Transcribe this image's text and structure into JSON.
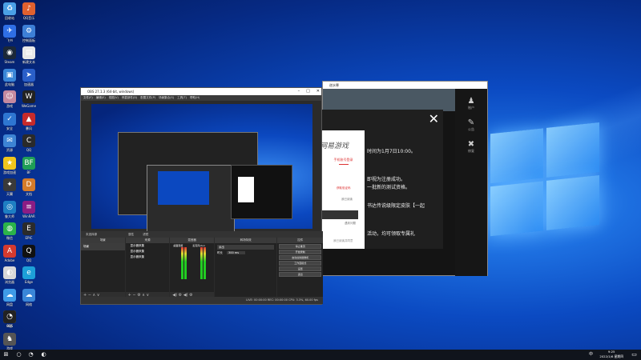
{
  "desktop_icons": [
    {
      "label": "回收站",
      "icon": "recycle-bin-icon",
      "color": "#4aa0e6",
      "glyph": "♻"
    },
    {
      "label": "QQ音乐",
      "icon": "music-app-icon",
      "color": "#e0612f",
      "glyph": "♪"
    },
    {
      "label": "飞书",
      "icon": "feishu-icon",
      "color": "#2f6fe6",
      "glyph": "✈"
    },
    {
      "label": "控制面板",
      "icon": "control-panel-icon",
      "color": "#3d7fd6",
      "glyph": "⚙"
    },
    {
      "label": "Steam",
      "icon": "steam-icon",
      "color": "#1b2838",
      "glyph": "◉"
    },
    {
      "label": "新建文本",
      "icon": "text-file-icon",
      "color": "#e8e8e8",
      "glyph": "▤"
    },
    {
      "label": "此电脑",
      "icon": "computer-icon",
      "color": "#3a86d8",
      "glyph": "▣"
    },
    {
      "label": "加速器",
      "icon": "accelerator-icon",
      "color": "#2a5fc9",
      "glyph": "➤"
    },
    {
      "label": "游戏",
      "icon": "game-avatar-icon",
      "color": "#c58aa0",
      "glyph": "☺"
    },
    {
      "label": "WeGame",
      "icon": "wegame-icon",
      "color": "#222222",
      "glyph": "W"
    },
    {
      "label": "安全",
      "icon": "shield-app-icon",
      "color": "#2e76d1",
      "glyph": "✓"
    },
    {
      "label": "暴风",
      "icon": "storm-icon",
      "color": "#c72b2b",
      "glyph": "▲"
    },
    {
      "label": "资源",
      "icon": "resource-icon",
      "color": "#3d84d4",
      "glyph": "✉"
    },
    {
      "label": "QQ",
      "icon": "cloud-app-icon",
      "color": "#2a2a2a",
      "glyph": "C"
    },
    {
      "label": "游戏加速",
      "icon": "game-speed-icon",
      "color": "#f0c51c",
      "glyph": "★"
    },
    {
      "label": "BF",
      "icon": "bf-app-icon",
      "color": "#1f9e57",
      "glyph": "BF"
    },
    {
      "label": "天翼",
      "icon": "wing-icon",
      "color": "#3a3a3a",
      "glyph": "✦"
    },
    {
      "label": "文档",
      "icon": "office-icon",
      "color": "#d47b2a",
      "glyph": "D"
    },
    {
      "label": "鲁大师",
      "icon": "tuning-icon",
      "color": "#1e7fc3",
      "glyph": "◎"
    },
    {
      "label": "WinRAR",
      "icon": "winrar-icon",
      "color": "#8b1d84",
      "glyph": "≡"
    },
    {
      "label": "微信",
      "icon": "wechat-icon",
      "color": "#2bb34a",
      "glyph": "◍"
    },
    {
      "label": "EPIC",
      "icon": "epic-icon",
      "color": "#2b2b2b",
      "glyph": "E"
    },
    {
      "label": "Adobe",
      "icon": "adobe-icon",
      "color": "#d43a2f",
      "glyph": "A"
    },
    {
      "label": "QQ",
      "icon": "qq-icon",
      "color": "#111111",
      "glyph": "Q"
    },
    {
      "label": "浏览器",
      "icon": "browser-icon",
      "color": "#d8d8d8",
      "glyph": "◐"
    },
    {
      "label": "Edge",
      "icon": "edge-icon",
      "color": "#1da0d8",
      "glyph": "e"
    },
    {
      "label": "网盘",
      "icon": "cloud-drive-icon",
      "color": "#3f9be8",
      "glyph": "☁"
    },
    {
      "label": "网络",
      "icon": "network-icon",
      "color": "#3a86d8",
      "glyph": "☁"
    },
    {
      "label": "R星",
      "icon": "rockstar-icon",
      "color": "#f0b31c",
      "glyph": "R"
    },
    {
      "label": "OBS",
      "icon": "obs-icon",
      "color": "#222222",
      "glyph": "◔"
    },
    {
      "label": "游戏",
      "icon": "game-icon",
      "color": "#555555",
      "glyph": "♞"
    }
  ],
  "obs": {
    "title": "OBS 27.1.3 (64-bit, windows)",
    "menu": [
      "文件(F)",
      "编辑(E)",
      "视图(V)",
      "停靠部件(D)",
      "配置文件(P)",
      "场景集合(S)",
      "工具(T)",
      "帮助(H)"
    ],
    "control_row_label": "未选择源",
    "preview_buttons": [
      "属性",
      "滤镜"
    ],
    "docks": {
      "scenes": {
        "title": "场景",
        "item": "场景"
      },
      "sources": {
        "title": "来源",
        "items": [
          "显示器采集",
          "显示器采集",
          "显示器采集"
        ]
      },
      "mixer": {
        "title": "混音器",
        "channels": [
          "桌面音频",
          "麦克风/Aux"
        ],
        "db": [
          "0.0 dB",
          "0.0 dB"
        ]
      },
      "transitions": {
        "title": "转场特效",
        "selected": "淡出",
        "duration_label": "时长",
        "duration_value": "300 ms"
      },
      "controls": {
        "title": "控件",
        "buttons": [
          "停止推流",
          "开始录制",
          "启动虚拟摄像机",
          "工作室模式",
          "设置",
          "退出"
        ]
      }
    },
    "status": "LIVE: 00:00:00   REC: 00:00:00   CPU: 3.3%, 60.00 fps"
  },
  "game": {
    "title": "逆水寒",
    "sidebar": [
      {
        "label": "账户",
        "icon": "user-icon",
        "glyph": "♟"
      },
      {
        "label": "公告",
        "icon": "notice-icon",
        "glyph": "✎"
      },
      {
        "label": "修复",
        "icon": "repair-icon",
        "glyph": "✖"
      }
    ],
    "notice_lines": [
      "时间为1月7日10:00。",
      "即视为注册成功。",
      "一批新的测试资格。",
      "书达传说级限定皮肤【一起",
      "活动，均可领取专属礼"
    ],
    "close_glyph": "✕"
  },
  "login": {
    "logo": "网易游戏",
    "tab": "手机账号登录",
    "get_code": "获取验证码",
    "agree": "我已阅读",
    "register": "遇到问题",
    "footer": "我已阅读并同意"
  },
  "taskbar": {
    "time": "9:25",
    "date": "2022/1/6 星期四",
    "lang": "中"
  }
}
